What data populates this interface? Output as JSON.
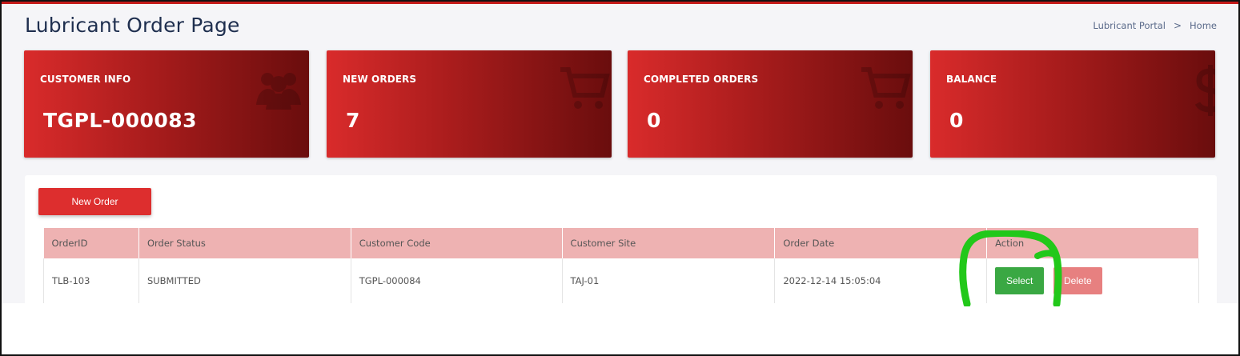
{
  "page": {
    "title": "Lubricant Order Page"
  },
  "breadcrumb": {
    "items": [
      "Lubricant Portal",
      "Home"
    ],
    "separator": ">"
  },
  "cards": [
    {
      "label": "CUSTOMER INFO",
      "value": "TGPL-000083",
      "icon": "users-icon"
    },
    {
      "label": "NEW ORDERS",
      "value": "7",
      "icon": "cart-icon"
    },
    {
      "label": "COMPLETED ORDERS",
      "value": "0",
      "icon": "cart-icon"
    },
    {
      "label": "BALANCE",
      "value": "0",
      "icon": "dollar-icon"
    }
  ],
  "panel": {
    "new_order_label": "New Order"
  },
  "table": {
    "headers": [
      "OrderID",
      "Order Status",
      "Customer Code",
      "Customer Site",
      "Order Date",
      "Action"
    ],
    "rows": [
      {
        "order_id": "TLB-103",
        "status": "SUBMITTED",
        "customer_code": "TGPL-000084",
        "customer_site": "TAJ-01",
        "order_date": "2022-12-14 15:05:04",
        "select_label": "Select",
        "delete_label": "Delete"
      }
    ]
  },
  "colors": {
    "accent": "#c41a1a",
    "card_gradient_start": "#d92b2b",
    "card_gradient_end": "#6a0d0d",
    "table_header": "#eeb2b2",
    "select_button": "#3aa843",
    "delete_button": "#e78080",
    "annotation": "#22c81a"
  }
}
